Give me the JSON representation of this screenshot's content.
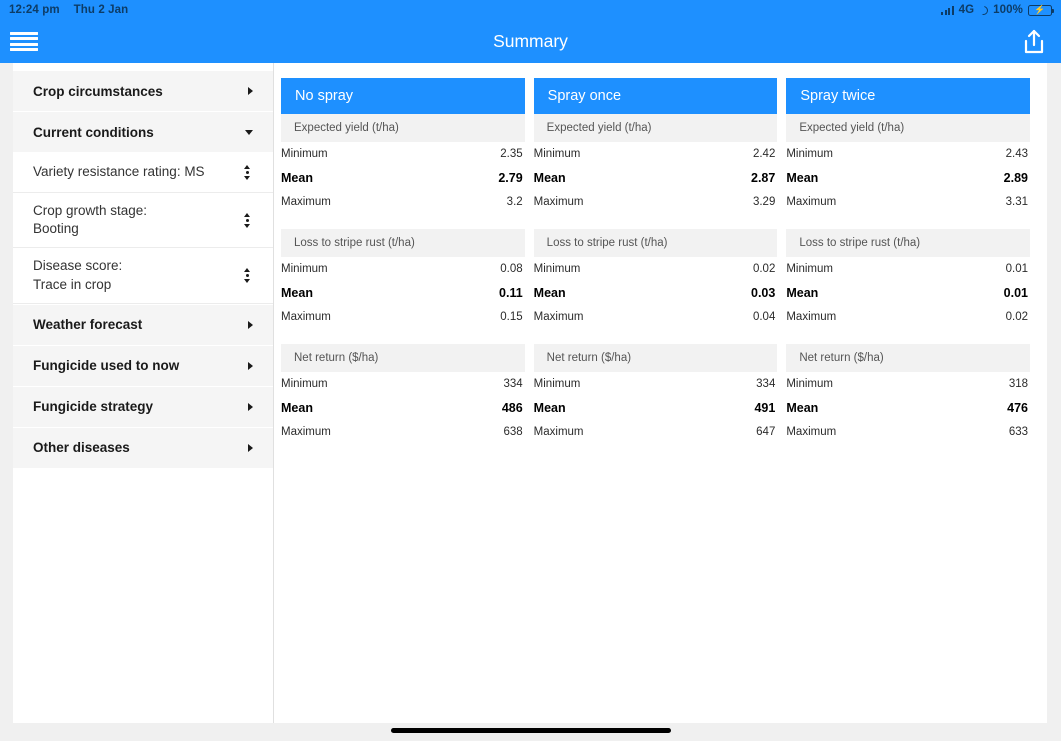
{
  "status_bar": {
    "time": "12:24 pm",
    "date": "Thu 2 Jan",
    "network": "4G",
    "battery_percent": "100%",
    "signal_icon": "signal-bars-icon",
    "dnd_icon": "moon-icon",
    "battery_icon": "battery-charging-icon",
    "charging_bolt": "⚡",
    "battery_color": "#3ddc6a"
  },
  "nav": {
    "menu_icon": "hamburger-menu-icon",
    "title": "Summary",
    "share_icon": "share-icon",
    "accent_color": "#1e90ff"
  },
  "sidebar": {
    "sections": [
      {
        "label": "Crop circumstances",
        "expanded": false,
        "chevron": "chevron-right-icon"
      },
      {
        "label": "Current conditions",
        "expanded": true,
        "chevron": "caret-down-icon"
      }
    ],
    "current_conditions_items": [
      {
        "label": "Variety resistance rating: MS",
        "control": "stepper-icon"
      },
      {
        "label": "Crop growth stage:\nBooting",
        "control": "stepper-icon"
      },
      {
        "label": "Disease score:\nTrace in crop",
        "control": "stepper-icon"
      }
    ],
    "more_sections": [
      {
        "label": "Weather forecast",
        "expanded": false,
        "chevron": "chevron-right-icon"
      },
      {
        "label": "Fungicide used to now",
        "expanded": false,
        "chevron": "chevron-right-icon"
      },
      {
        "label": "Fungicide strategy",
        "expanded": false,
        "chevron": "chevron-right-icon"
      },
      {
        "label": "Other diseases",
        "expanded": false,
        "chevron": "chevron-right-icon"
      }
    ]
  },
  "row_labels": {
    "minimum": "Minimum",
    "mean": "Mean",
    "maximum": "Maximum"
  },
  "cards": [
    {
      "title": "No spray",
      "metrics": [
        {
          "title": "Expected yield (t/ha)",
          "minimum": "2.35",
          "mean": "2.79",
          "maximum": "3.2"
        },
        {
          "title": "Loss to stripe rust (t/ha)",
          "minimum": "0.08",
          "mean": "0.11",
          "maximum": "0.15"
        },
        {
          "title": "Net return ($/ha)",
          "minimum": "334",
          "mean": "486",
          "maximum": "638"
        }
      ]
    },
    {
      "title": "Spray once",
      "metrics": [
        {
          "title": "Expected yield (t/ha)",
          "minimum": "2.42",
          "mean": "2.87",
          "maximum": "3.29"
        },
        {
          "title": "Loss to stripe rust (t/ha)",
          "minimum": "0.02",
          "mean": "0.03",
          "maximum": "0.04"
        },
        {
          "title": "Net return ($/ha)",
          "minimum": "334",
          "mean": "491",
          "maximum": "647"
        }
      ]
    },
    {
      "title": "Spray twice",
      "metrics": [
        {
          "title": "Expected yield (t/ha)",
          "minimum": "2.43",
          "mean": "2.89",
          "maximum": "3.31"
        },
        {
          "title": "Loss to stripe rust (t/ha)",
          "minimum": "0.01",
          "mean": "0.01",
          "maximum": "0.02"
        },
        {
          "title": "Net return ($/ha)",
          "minimum": "318",
          "mean": "476",
          "maximum": "633"
        }
      ]
    }
  ],
  "home_indicator": "home-indicator"
}
